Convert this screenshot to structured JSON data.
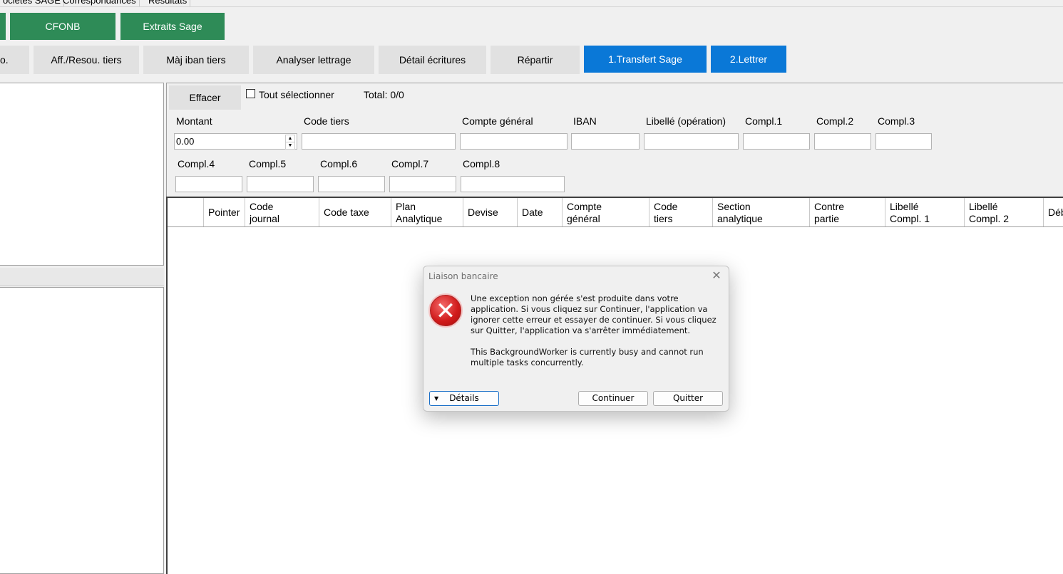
{
  "top_tabs": [
    "ociétés SAGE",
    "Correspondances",
    "Résultats"
  ],
  "green_buttons": [
    "CFONB",
    "Extraits Sage"
  ],
  "toolbar": {
    "partial_left": "o.",
    "aff_resou": "Aff./Resou. tiers",
    "maj_iban": "Màj iban tiers",
    "analyser": "Analyser lettrage",
    "detail": "Détail écritures",
    "repartir": "Répartir",
    "transfert": "1.Transfert Sage",
    "lettrer": "2.Lettrer"
  },
  "filter": {
    "effacer": "Effacer",
    "select_all": "Tout sélectionner",
    "total": "Total: 0/0",
    "montant_label": "Montant",
    "montant_value": "0.00",
    "code_tiers": "Code tiers",
    "compte_general": "Compte général",
    "iban": "IBAN",
    "libelle_operation": "Libellé (opération)",
    "compl1": "Compl.1",
    "compl2": "Compl.2",
    "compl3": "Compl.3",
    "compl4": "Compl.4",
    "compl5": "Compl.5",
    "compl6": "Compl.6",
    "compl7": "Compl.7",
    "compl8": "Compl.8"
  },
  "grid_columns": [
    "",
    "Pointer",
    "Code\njournal",
    "Code taxe",
    "Plan\nAnalytique",
    "Devise",
    "Date",
    "Compte\ngénéral",
    "Code\ntiers",
    "Section\nanalytique",
    "Contre\npartie",
    "Libellé\nCompl. 1",
    "Libellé\nCompl. 2",
    "Déb"
  ],
  "dialog": {
    "title": "Liaison bancaire",
    "message": "Une exception non gérée s'est produite dans votre application. Si vous cliquez sur Continuer, l'application va ignorer cette erreur et essayer de continuer. Si vous cliquez sur Quitter, l'application va s'arrêter immédiatement.",
    "detail_message": "This BackgroundWorker is currently busy and cannot run multiple tasks concurrently.",
    "details_button": "Détails",
    "continue_button": "Continuer",
    "quit_button": "Quitter"
  },
  "colors": {
    "green": "#2e8b57",
    "blue": "#0a78d7",
    "grey_button": "#e1e1e1",
    "background": "#f0f0f0"
  }
}
